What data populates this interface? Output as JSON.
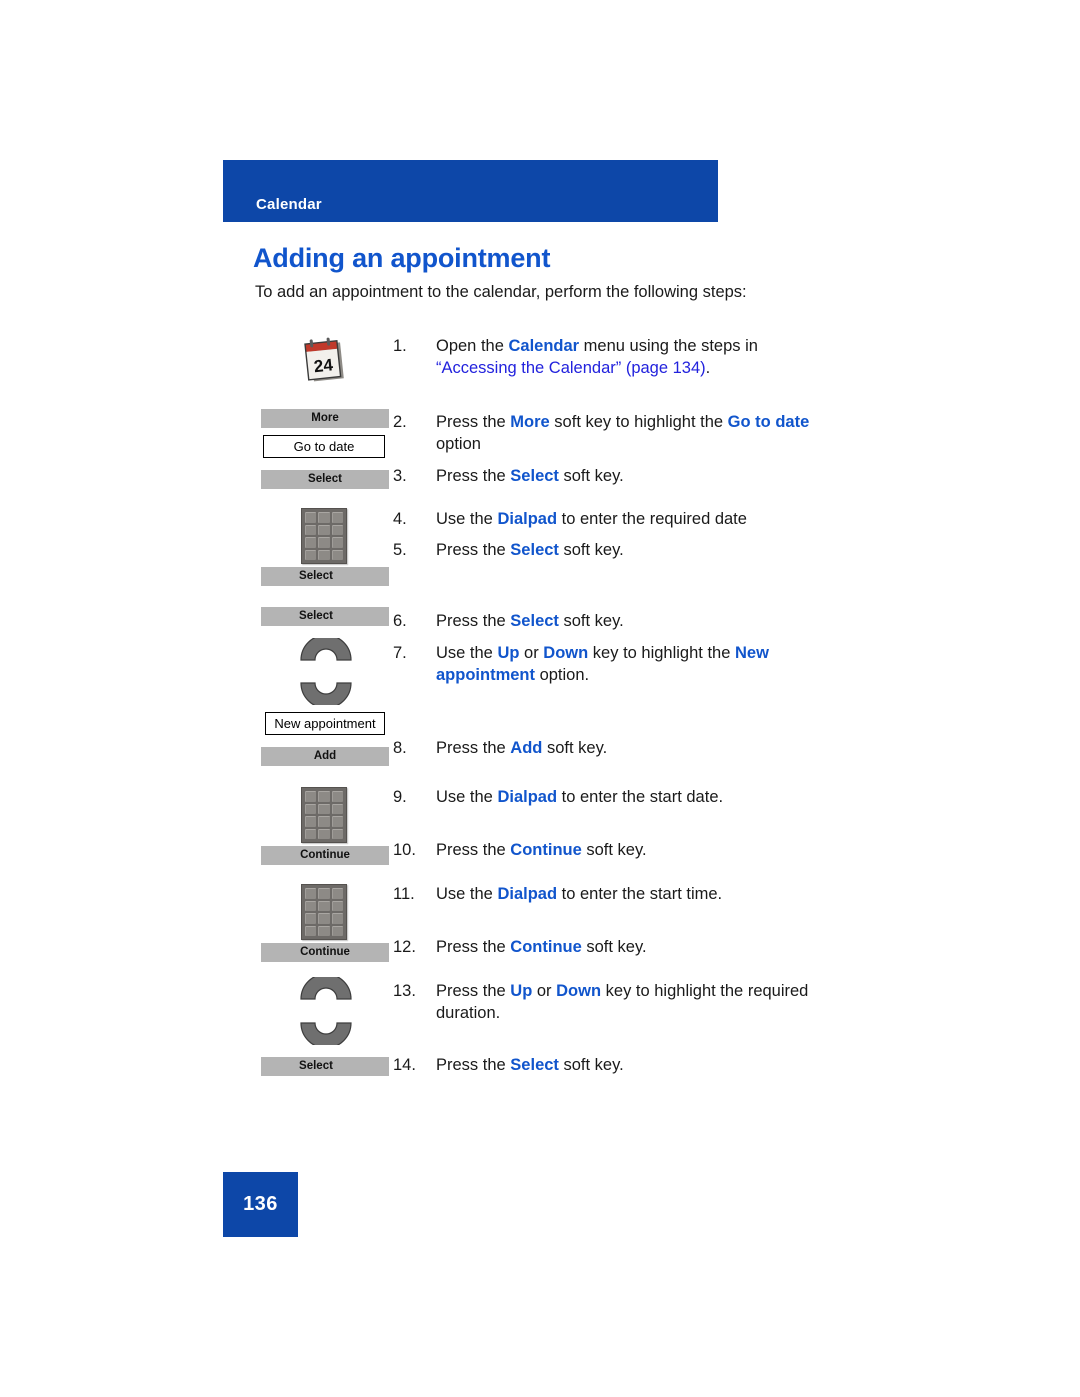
{
  "header": {
    "band_label": "Calendar",
    "band_color": "#0d47a8"
  },
  "page_title": "Adding an appointment",
  "intro": "To add an appointment to the calendar, perform the following steps:",
  "colors": {
    "accent_blue": "#0d47a8",
    "term_blue": "#1155cc",
    "link_blue": "#2222dd",
    "softkey_gray": "#b4b4b4"
  },
  "steps": [
    {
      "number": "1.",
      "art": "calendar-icon",
      "art_label": "24",
      "parts": [
        {
          "t": "Open the ",
          "s": "plain"
        },
        {
          "t": "Calendar",
          "s": "term"
        },
        {
          "t": " menu using the steps in ",
          "s": "plain"
        },
        {
          "t": "“Accessing the Calendar” (page 134)",
          "s": "xref"
        },
        {
          "t": ".",
          "s": "plain"
        }
      ]
    },
    {
      "number": "2.",
      "art": "softkey-and-option",
      "softkey_label": "More",
      "option_label": "Go to date",
      "parts": [
        {
          "t": "Press the ",
          "s": "plain"
        },
        {
          "t": "More",
          "s": "term"
        },
        {
          "t": " soft key to highlight the ",
          "s": "plain"
        },
        {
          "t": "Go to date",
          "s": "term"
        },
        {
          "t": " option",
          "s": "plain"
        }
      ]
    },
    {
      "number": "3.",
      "art": "softkey",
      "softkey_label": "Select",
      "parts": [
        {
          "t": "Press the ",
          "s": "plain"
        },
        {
          "t": "Select",
          "s": "term"
        },
        {
          "t": " soft key.",
          "s": "plain"
        }
      ]
    },
    {
      "number": "4.",
      "art": "dialpad-icon",
      "parts": [
        {
          "t": "Use the ",
          "s": "plain"
        },
        {
          "t": "Dialpad",
          "s": "term"
        },
        {
          "t": " to enter the required date",
          "s": "plain"
        }
      ]
    },
    {
      "number": "5.",
      "art": "softkey",
      "softkey_label": "Select",
      "parts": [
        {
          "t": "Press the ",
          "s": "plain"
        },
        {
          "t": "Select",
          "s": "term"
        },
        {
          "t": " soft key.",
          "s": "plain"
        }
      ]
    },
    {
      "number": "6.",
      "art": "softkey",
      "softkey_label": "Select",
      "parts": [
        {
          "t": "Press the ",
          "s": "plain"
        },
        {
          "t": "Select",
          "s": "term"
        },
        {
          "t": " soft key.",
          "s": "plain"
        }
      ]
    },
    {
      "number": "7.",
      "art": "navkeys-and-option",
      "option_label": "New appointment",
      "parts": [
        {
          "t": " Use the ",
          "s": "plain"
        },
        {
          "t": "Up",
          "s": "term"
        },
        {
          "t": " or ",
          "s": "plain"
        },
        {
          "t": "Down",
          "s": "term"
        },
        {
          "t": " key to highlight the ",
          "s": "plain"
        },
        {
          "t": "New appointment",
          "s": "term"
        },
        {
          "t": " option.",
          "s": "plain"
        }
      ]
    },
    {
      "number": "8.",
      "art": "softkey",
      "softkey_label": "Add",
      "parts": [
        {
          "t": "Press the ",
          "s": "plain"
        },
        {
          "t": "Add",
          "s": "term"
        },
        {
          "t": " soft key.",
          "s": "plain"
        }
      ]
    },
    {
      "number": "9.",
      "art": "dialpad-icon",
      "parts": [
        {
          "t": "Use the ",
          "s": "plain"
        },
        {
          "t": "Dialpad",
          "s": "term"
        },
        {
          "t": " to enter the start date.",
          "s": "plain"
        }
      ]
    },
    {
      "number": "10.",
      "art": "softkey",
      "softkey_label": "Continue",
      "parts": [
        {
          "t": "Press the ",
          "s": "plain"
        },
        {
          "t": "Continue",
          "s": "term"
        },
        {
          "t": " soft key.",
          "s": "plain"
        }
      ]
    },
    {
      "number": "11.",
      "art": "dialpad-icon",
      "parts": [
        {
          "t": "Use the ",
          "s": "plain"
        },
        {
          "t": "Dialpad",
          "s": "term"
        },
        {
          "t": " to enter the start time.",
          "s": "plain"
        }
      ]
    },
    {
      "number": "12.",
      "art": "softkey",
      "softkey_label": "Continue",
      "parts": [
        {
          "t": "Press the ",
          "s": "plain"
        },
        {
          "t": "Continue",
          "s": "term"
        },
        {
          "t": " soft key.",
          "s": "plain"
        }
      ]
    },
    {
      "number": "13.",
      "art": "navkeys",
      "parts": [
        {
          "t": "Press the ",
          "s": "plain"
        },
        {
          "t": "Up",
          "s": "term"
        },
        {
          "t": " or ",
          "s": "plain"
        },
        {
          "t": "Down",
          "s": "term"
        },
        {
          "t": " key to highlight the required duration.",
          "s": "plain"
        }
      ]
    },
    {
      "number": "14.",
      "art": "softkey",
      "softkey_label": "Select",
      "parts": [
        {
          "t": "Press the ",
          "s": "plain"
        },
        {
          "t": "Select",
          "s": "term"
        },
        {
          "t": " soft key.",
          "s": "plain"
        }
      ]
    }
  ],
  "footer": {
    "page_number": "136"
  }
}
